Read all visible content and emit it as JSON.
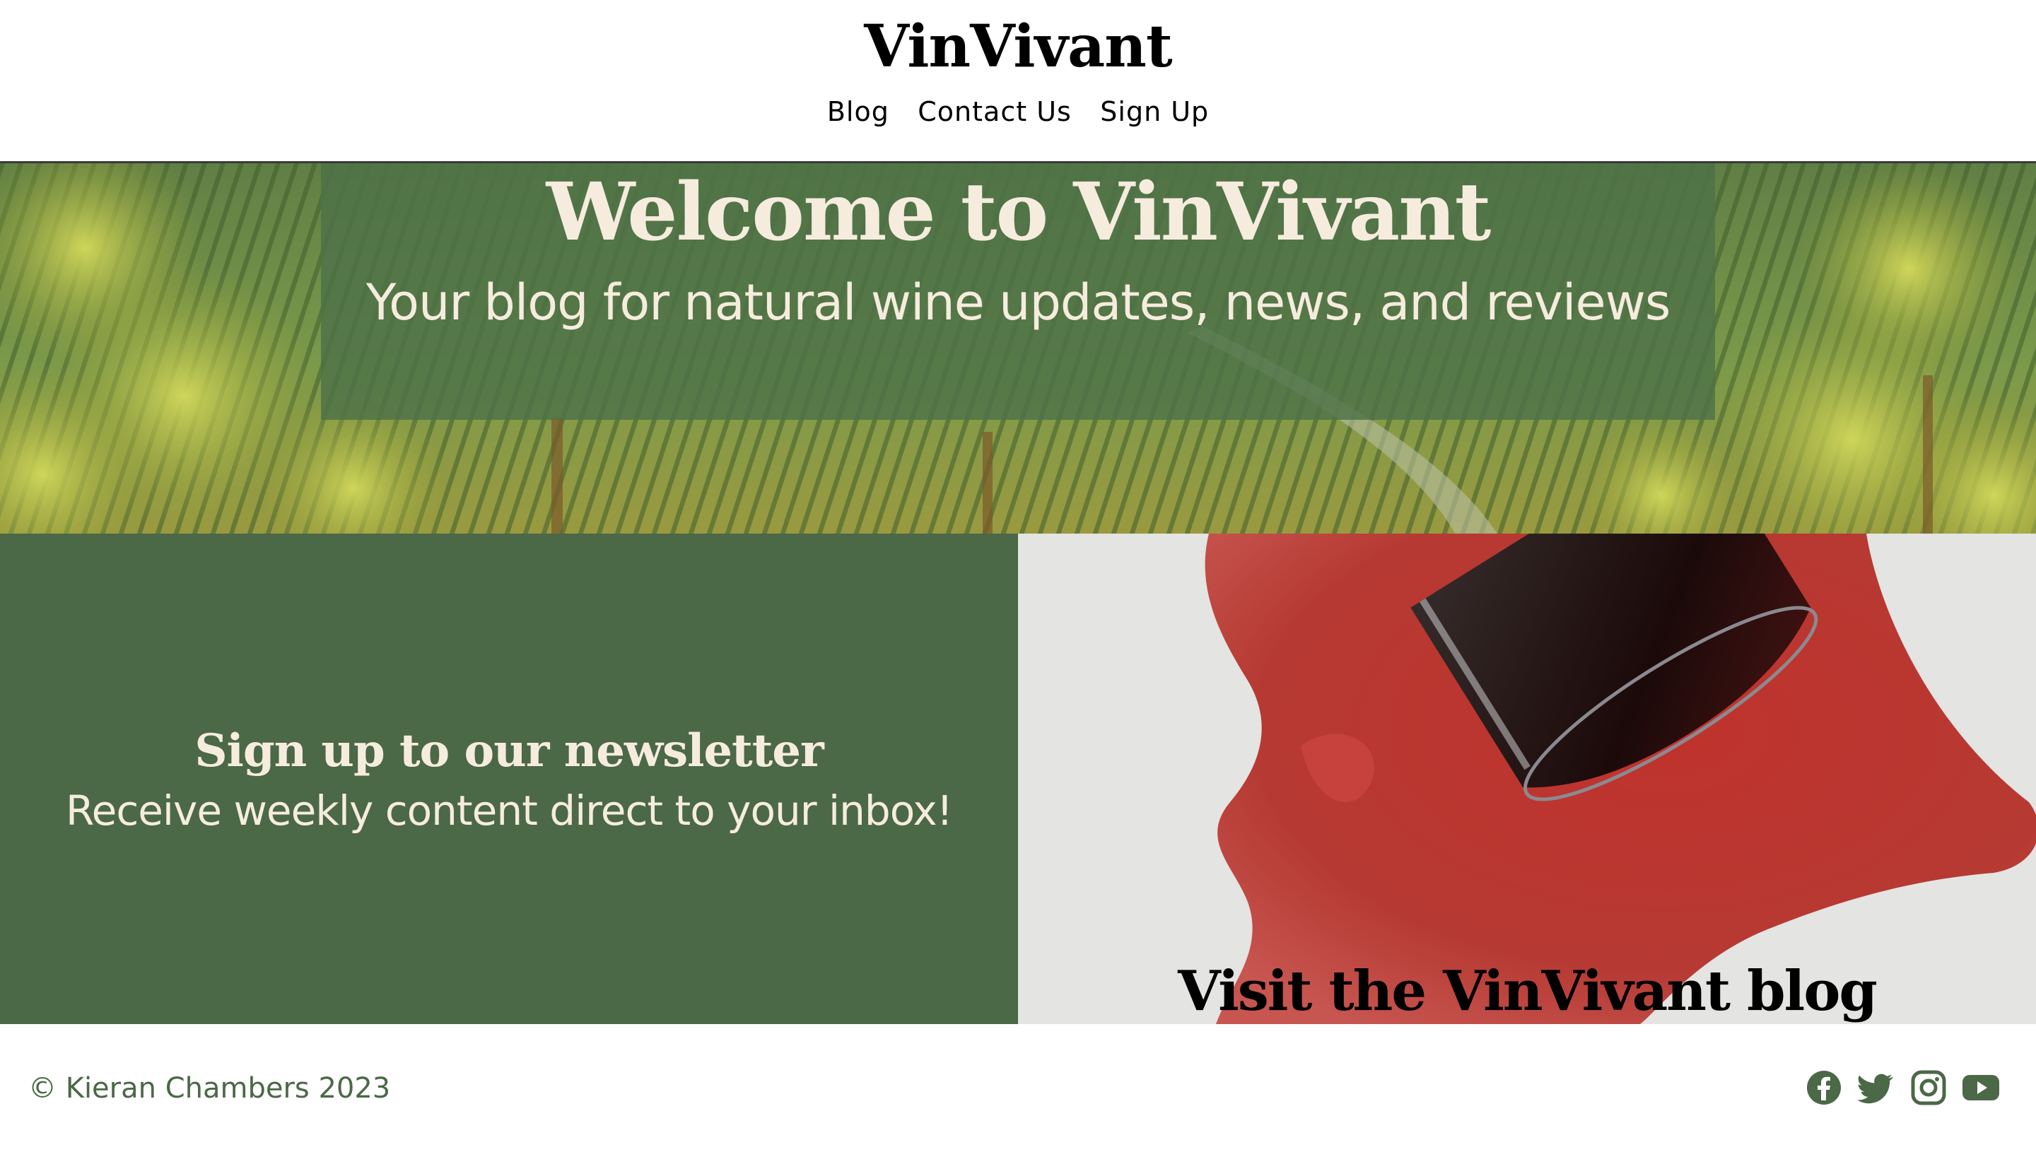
{
  "brand": {
    "name": "VinVivant"
  },
  "nav": {
    "items": [
      "Blog",
      "Contact Us",
      "Sign Up"
    ]
  },
  "hero": {
    "title": "Welcome to VinVivant",
    "subtitle": "Your blog for natural wine updates, news, and reviews"
  },
  "newsletter": {
    "title": "Sign up to our newsletter",
    "subtitle": "Receive weekly content direct to your inbox!"
  },
  "blog_promo": {
    "link_label": "Visit the VinVivant blog"
  },
  "footer": {
    "copyright": "© Kieran Chambers 2023",
    "socials": [
      "facebook-icon",
      "twitter-icon",
      "instagram-icon",
      "youtube-icon"
    ]
  },
  "colors": {
    "brand_green": "#4b6847",
    "cream": "#f6ecdd",
    "wine_red": "#b8322e"
  }
}
